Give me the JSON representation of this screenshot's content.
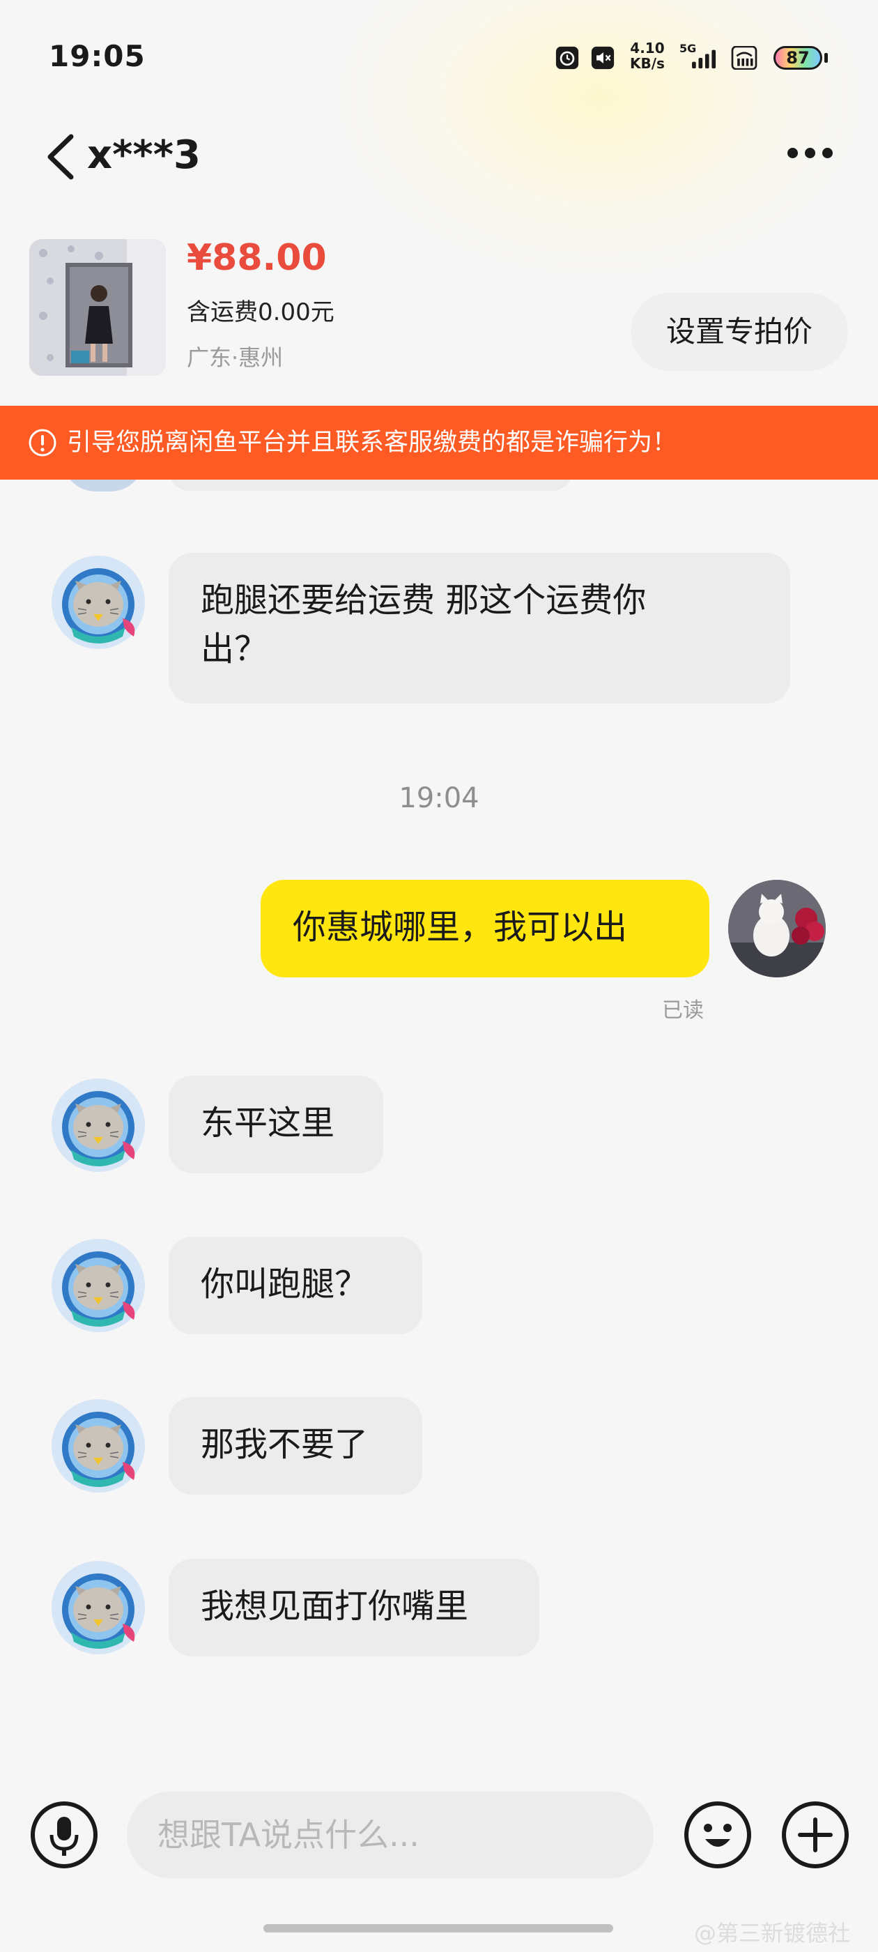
{
  "status_bar": {
    "time": "19:05",
    "speed_value": "4.10",
    "speed_unit": "KB/s",
    "network": "5G",
    "battery": "87"
  },
  "header": {
    "title": "x***3"
  },
  "product": {
    "price": "¥88.00",
    "shipping": "含运费0.00元",
    "location": "广东·惠州",
    "special_price_button": "设置专拍价"
  },
  "warning": {
    "text": "引导您脱离闲鱼平台并且联系客服缴费的都是诈骗行为！"
  },
  "messages": [
    {
      "from": "other",
      "text_line1": "跑腿还要给运费 那这个运费你",
      "text_line2": "出？"
    },
    {
      "from": "system",
      "text": "19:04"
    },
    {
      "from": "me",
      "text": "你惠城哪里，我可以出",
      "status": "已读"
    },
    {
      "from": "other",
      "text": "东平这里"
    },
    {
      "from": "other",
      "text": "你叫跑腿？"
    },
    {
      "from": "other",
      "text": "那我不要了"
    },
    {
      "from": "other",
      "text": "我想见面打你嘴里"
    }
  ],
  "input": {
    "placeholder": "想跟TA说点什么..."
  },
  "watermark": "@第三新镀德社",
  "icons": [
    "back-icon",
    "more-icon",
    "alarm-icon",
    "mute-icon",
    "signal-icon",
    "wifi-icon",
    "warning-icon",
    "microphone-icon",
    "emoji-icon",
    "plus-icon"
  ],
  "colors": {
    "price": "#e94b3c",
    "warning_bar": "#fe5a23",
    "my_bubble": "#ffe60f",
    "other_bubble": "#ececec"
  }
}
